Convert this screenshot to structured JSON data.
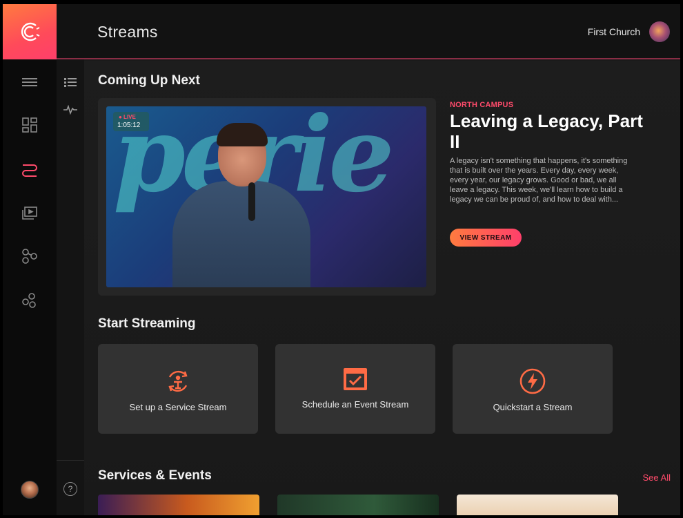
{
  "app": {
    "title": "Streams",
    "org_name": "First Church"
  },
  "rail": {
    "items": [
      {
        "icon": "menu-icon"
      },
      {
        "icon": "dashboard-icon"
      },
      {
        "icon": "streams-icon",
        "active": true
      },
      {
        "icon": "media-icon"
      },
      {
        "icon": "connections-icon"
      },
      {
        "icon": "integrations-icon"
      }
    ],
    "accent": "#ff4b6b"
  },
  "rail2": {
    "items": [
      {
        "icon": "list-icon"
      },
      {
        "icon": "activity-icon"
      }
    ],
    "help": "?"
  },
  "coming_up": {
    "heading": "Coming Up Next",
    "live_label": "● LIVE",
    "live_time": "1:05:12",
    "campus": "NORTH CAMPUS",
    "title": "Leaving a Legacy, Part II",
    "description": "A legacy isn't something that happens, it's something that is built over the years. Every day, every week, every year, our legacy grows. Good or bad, we all leave a legacy. This week, we'll learn how to build a legacy we can be proud of, and how to deal with...",
    "button": "VIEW STREAM"
  },
  "start_streaming": {
    "heading": "Start Streaming",
    "actions": [
      {
        "label": "Set up a Service Stream",
        "icon": "service-stream-icon"
      },
      {
        "label": "Schedule an Event Stream",
        "icon": "calendar-check-icon"
      },
      {
        "label": "Quickstart a Stream",
        "icon": "lightning-icon"
      }
    ]
  },
  "services_events": {
    "heading": "Services & Events",
    "see_all": "See All"
  },
  "colors": {
    "accent_gradient_start": "#ff7b3f",
    "accent_gradient_end": "#ff3f6b",
    "background": "#1a1a1a"
  }
}
